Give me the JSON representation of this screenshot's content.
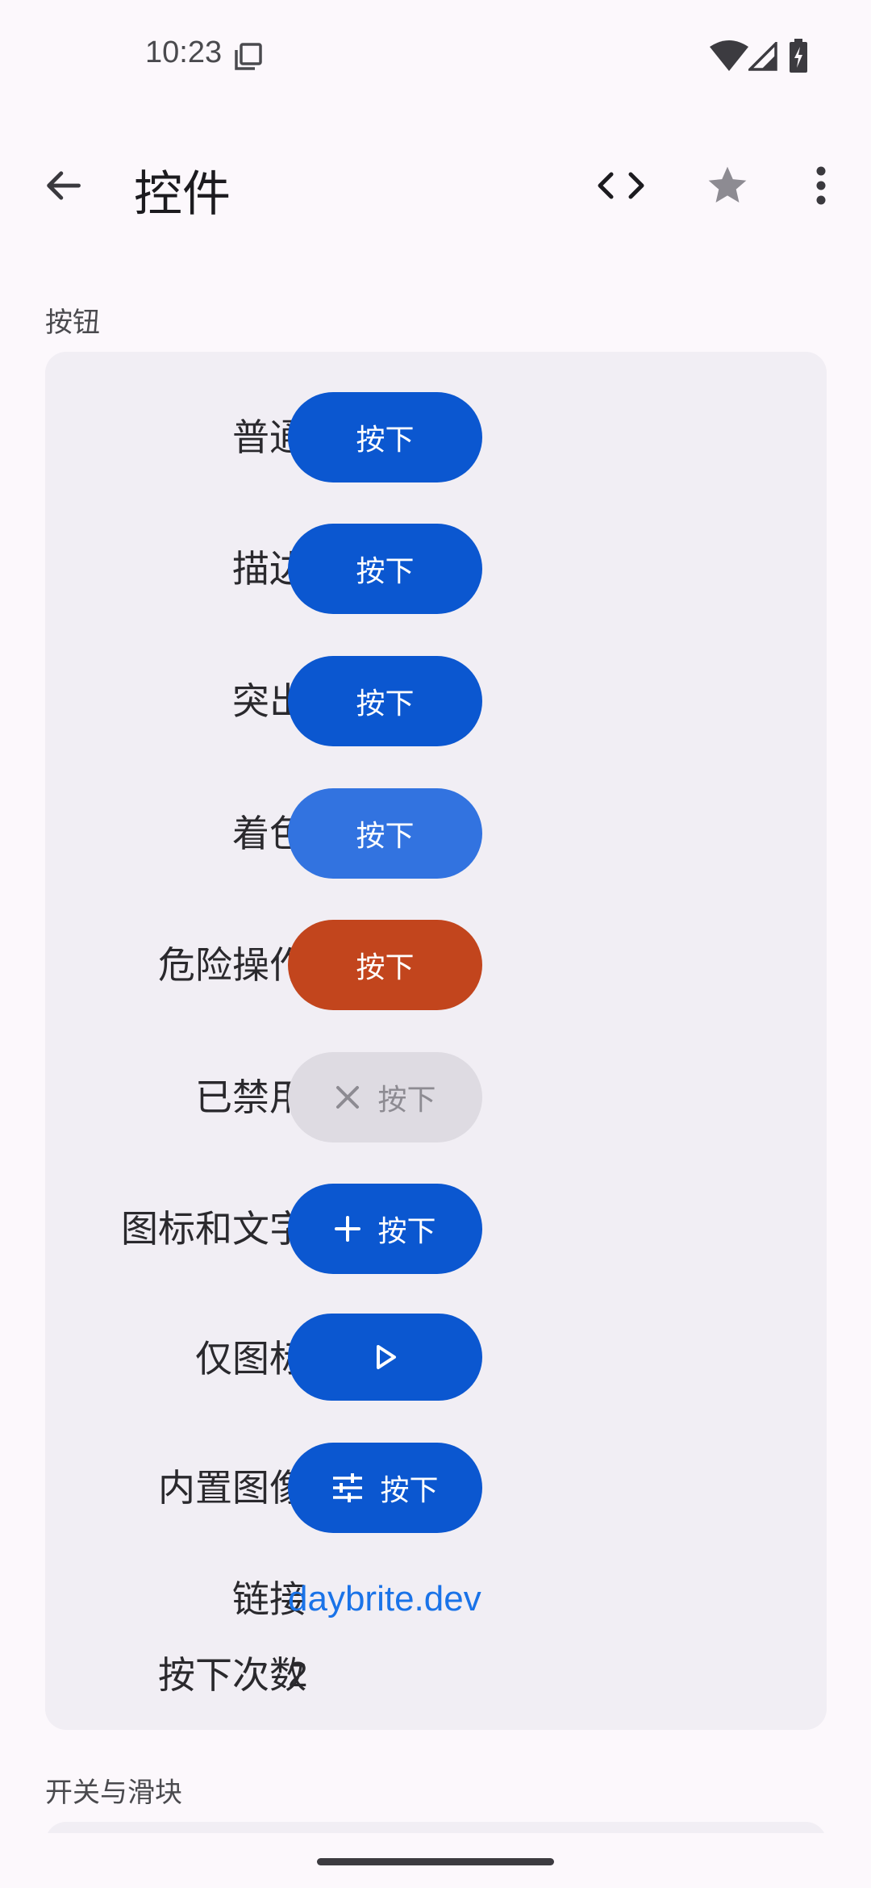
{
  "status_bar": {
    "time": "10:23"
  },
  "app_bar": {
    "title": "控件"
  },
  "sections": {
    "buttons_title": "按钮",
    "switches_title": "开关与滑块"
  },
  "buttons": {
    "rows": [
      {
        "label": "普通",
        "button_text": "按下"
      },
      {
        "label": "描边",
        "button_text": "按下"
      },
      {
        "label": "突出",
        "button_text": "按下"
      },
      {
        "label": "着色",
        "button_text": "按下"
      },
      {
        "label": "危险操作",
        "button_text": "按下"
      },
      {
        "label": "已禁用",
        "button_text": "按下"
      },
      {
        "label": "图标和文字",
        "button_text": "按下"
      },
      {
        "label": "仅图标",
        "button_text": ""
      },
      {
        "label": "内置图像",
        "button_text": "按下"
      }
    ],
    "link_label": "链接",
    "link_text": "daybrite.dev",
    "count_label": "按下次数",
    "count_value": "2"
  },
  "colors": {
    "primary": "#0b57d0",
    "tonal": "#3273e0",
    "danger": "#c2451d",
    "disabled_bg": "#dedbe2",
    "link": "#1a73e8",
    "card_bg": "#f1eef4",
    "page_bg": "#fcf8fc"
  },
  "icons": {
    "back": "arrow-back-icon",
    "code": "code-icon",
    "star": "star-icon",
    "more": "more-vert-icon",
    "disabled_button": "close-icon",
    "icon_text_button": "add-icon",
    "icon_only_button": "play-icon",
    "image_button": "tune-icon"
  }
}
